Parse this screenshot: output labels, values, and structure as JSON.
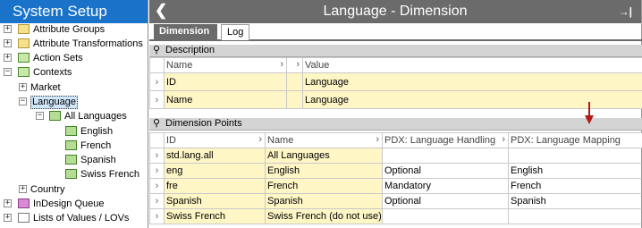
{
  "app": {
    "title": "System Setup"
  },
  "tree": {
    "items": [
      {
        "label": "Attribute Groups",
        "icon": "folder-icon",
        "expander": "+"
      },
      {
        "label": "Attribute Transformations",
        "icon": "folder-icon",
        "expander": "+"
      },
      {
        "label": "Action Sets",
        "icon": "action-sets-icon",
        "expander": "+"
      },
      {
        "label": "Contexts",
        "icon": "contexts-icon",
        "expander": "−"
      },
      {
        "label": "Market",
        "expander": "+"
      },
      {
        "label": "Language",
        "expander": "−",
        "selected": true
      },
      {
        "label": "All Languages",
        "icon": "dimension-point-icon",
        "expander": "−"
      },
      {
        "label": "English",
        "icon": "dimension-point-icon"
      },
      {
        "label": "French",
        "icon": "dimension-point-icon"
      },
      {
        "label": "Spanish",
        "icon": "dimension-point-icon"
      },
      {
        "label": "Swiss French",
        "icon": "dimension-point-icon"
      },
      {
        "label": "Country",
        "expander": "+"
      },
      {
        "label": "InDesign Queue",
        "icon": "queue-icon",
        "expander": "+"
      },
      {
        "label": "Lists of Values / LOVs",
        "icon": "list-icon",
        "expander": "+"
      }
    ]
  },
  "header": {
    "title": "Language - Dimension",
    "back_icon": "back-chevron-icon",
    "pin_icon": "pin-icon"
  },
  "tabs": [
    {
      "label": "Dimension",
      "active": true
    },
    {
      "label": "Log",
      "active": false
    }
  ],
  "description": {
    "section_title": "Description",
    "columns": [
      "Name",
      "",
      "Value"
    ],
    "rows": [
      {
        "name": "ID",
        "value": "Language"
      },
      {
        "name": "Name",
        "value": "Language"
      }
    ]
  },
  "dimension_points": {
    "section_title": "Dimension Points",
    "columns": [
      "ID",
      "Name",
      "PDX: Language Handling",
      "PDX: Language Mapping"
    ],
    "rows": [
      [
        "std.lang.all",
        "All Languages",
        "",
        ""
      ],
      [
        "eng",
        "English",
        "Optional",
        "English"
      ],
      [
        "fre",
        "French",
        "Mandatory",
        "French"
      ],
      [
        "Spanish",
        "Spanish",
        "Optional",
        "Spanish"
      ],
      [
        "Swiss French",
        "Swiss French (do not use)",
        "",
        ""
      ]
    ]
  },
  "colors": {
    "title_blue": "#1b73c9",
    "header_gray": "#6b6b6b",
    "row_yellow": "#fff6c6",
    "arrow_red": "#b21a1a"
  }
}
